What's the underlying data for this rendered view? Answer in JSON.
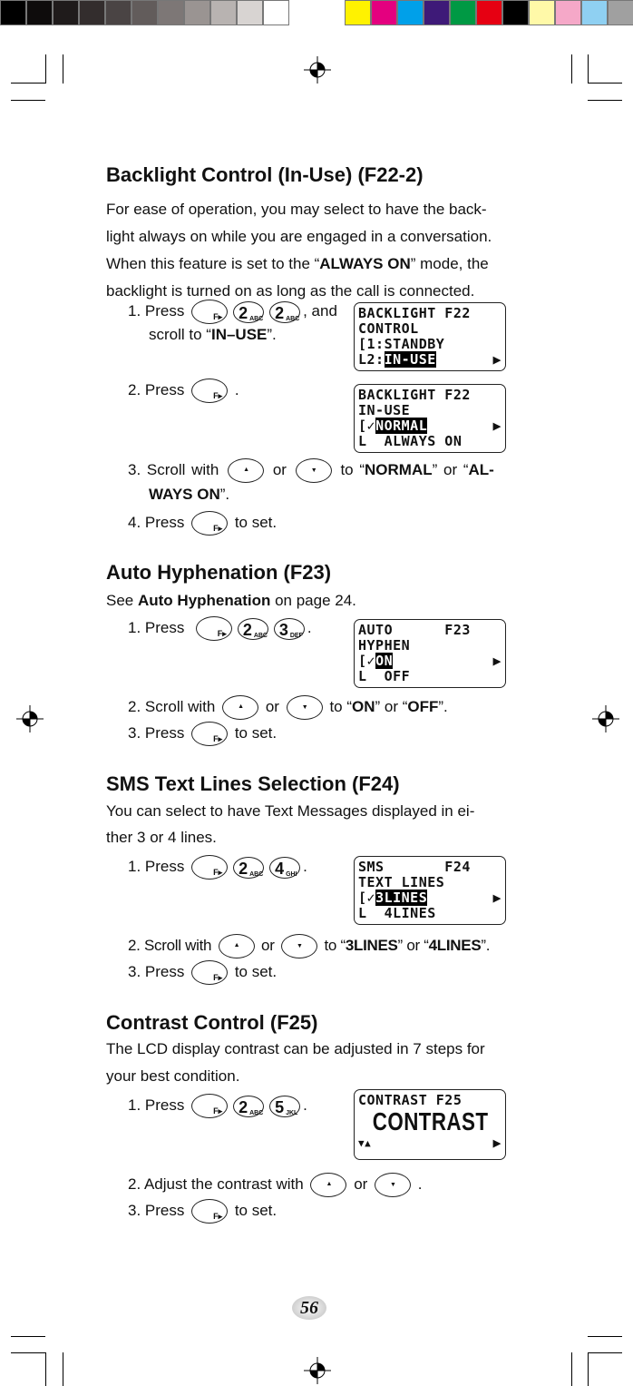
{
  "colors": {
    "gray_swatches": [
      "#000000",
      "#0e0c0c",
      "#1f1b1b",
      "#332d2d",
      "#4a4444",
      "#625c5b",
      "#7d7776",
      "#9a9492",
      "#b8b3b1",
      "#d8d4d2",
      "#ffffff"
    ],
    "color_swatches": [
      "#fff200",
      "#e4007f",
      "#00a0e9",
      "#3e1a78",
      "#009944",
      "#e60012",
      "#000000",
      "#fff9a8",
      "#f5a8c8",
      "#8fd0f2",
      "#a0a0a0"
    ]
  },
  "s1": {
    "heading": "Backlight Control (In-Use) (F22-2)",
    "para": [
      "For ease of operation, you may select to have the back-",
      "light always on while you are engaged in a conversation.",
      "When this feature is set to the “",
      "ALWAYS ON",
      "” mode, the",
      "backlight is turned on as long as the call is connected."
    ],
    "step1": [
      "1.  Press",
      ", and",
      "scroll to “",
      "IN–USE",
      "”."
    ],
    "step2": [
      "2.  Press",
      "."
    ],
    "step3": [
      "3.  Scroll with",
      "or",
      "to “",
      "NORMAL",
      "” or “",
      "AL-",
      "WAYS ON",
      "”."
    ],
    "step4": [
      "4.  Press",
      "to set."
    ],
    "lcd1": [
      "BACKLIGHT F22",
      "CONTROL",
      "[1:STANDBY",
      "L2:",
      "IN-USE",
      "▶"
    ],
    "lcd2": [
      "BACKLIGHT F22",
      "IN-USE",
      "[✓",
      "NORMAL",
      "▶",
      "L  ALWAYS ON"
    ]
  },
  "s2": {
    "heading": "Auto Hyphenation (F23)",
    "para": [
      "See ",
      "Auto Hyphenation",
      " on page 24."
    ],
    "step1": [
      "1.  Press",
      "."
    ],
    "step2": [
      "2.  Scroll with",
      "or",
      "to “",
      "ON",
      "” or “",
      "OFF",
      "”."
    ],
    "step3": [
      "3.  Press",
      "to set."
    ],
    "lcd": [
      "AUTO      F23",
      "HYPHEN",
      "[✓",
      "ON",
      "▶",
      "L  OFF"
    ]
  },
  "s3": {
    "heading": "SMS Text Lines Selection (F24)",
    "para": [
      "You can select to have Text Messages displayed in ei-",
      "ther 3 or 4 lines."
    ],
    "step1": [
      "1.  Press",
      "."
    ],
    "step2": [
      "2.  Scroll with",
      "or",
      "to “",
      "3LINES",
      "” or “",
      "4LINES",
      "”."
    ],
    "step3": [
      "3.  Press",
      "to set."
    ],
    "lcd": [
      "SMS       F24",
      "TEXT LINES",
      "[✓",
      "3LINES",
      "▶",
      "L  4LINES"
    ]
  },
  "s4": {
    "heading": "Contrast Control (F25)",
    "para": [
      "The LCD display contrast can be adjusted in 7 steps for",
      "your best condition."
    ],
    "step1": [
      "1.  Press",
      "."
    ],
    "step2": [
      "2.  Adjust the contrast with",
      "or",
      "."
    ],
    "step3": [
      "3.  Press",
      "to set."
    ],
    "lcd": [
      "CONTRAST F25",
      "CONTRAST",
      "▼▲",
      "▶"
    ]
  },
  "keys": {
    "f": "F▸",
    "two": "2",
    "abc": "ABC",
    "three": "3",
    "def": "DEF",
    "four": "4",
    "ghi": "GHI",
    "five": "5",
    "jkl": "JKL",
    "up": "▲",
    "down": "▼"
  },
  "page_number": "56"
}
